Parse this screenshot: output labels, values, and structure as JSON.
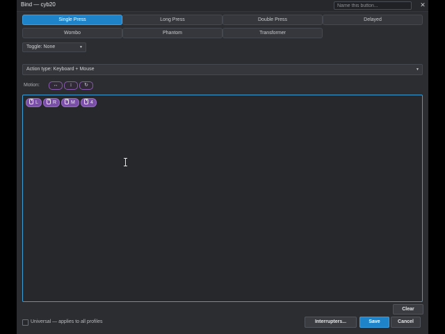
{
  "window": {
    "title": "Bind  —  cyb20",
    "name_placeholder": "Name this button...",
    "close_glyph": "✕"
  },
  "modes": {
    "row1": [
      "Single Press",
      "Long Press",
      "Double Press",
      "Delayed"
    ],
    "row2": [
      "Wombo",
      "Phantom",
      "Transformer"
    ],
    "active": "Single Press"
  },
  "toggle": {
    "label": "Toggle: None",
    "caret": "▼"
  },
  "action": {
    "label": "Action type:  Keyboard + Mouse",
    "caret": "▼"
  },
  "motion": {
    "label": "Motion:",
    "chips": [
      "↔",
      "↕",
      "↻"
    ]
  },
  "editor": {
    "tags": [
      "L",
      "R",
      "M",
      "4"
    ],
    "tag_icon": "mouse-icon"
  },
  "footer": {
    "clear": "Clear",
    "universal_label": "Universal — applies to all profiles",
    "universal_checked": false,
    "interrupters": "Interrupters...",
    "save": "Save",
    "cancel": "Cancel"
  },
  "colors": {
    "accent": "#1f83c9",
    "tag_purple": "#7a4fa8",
    "editor_border": "#3d9fd8"
  }
}
